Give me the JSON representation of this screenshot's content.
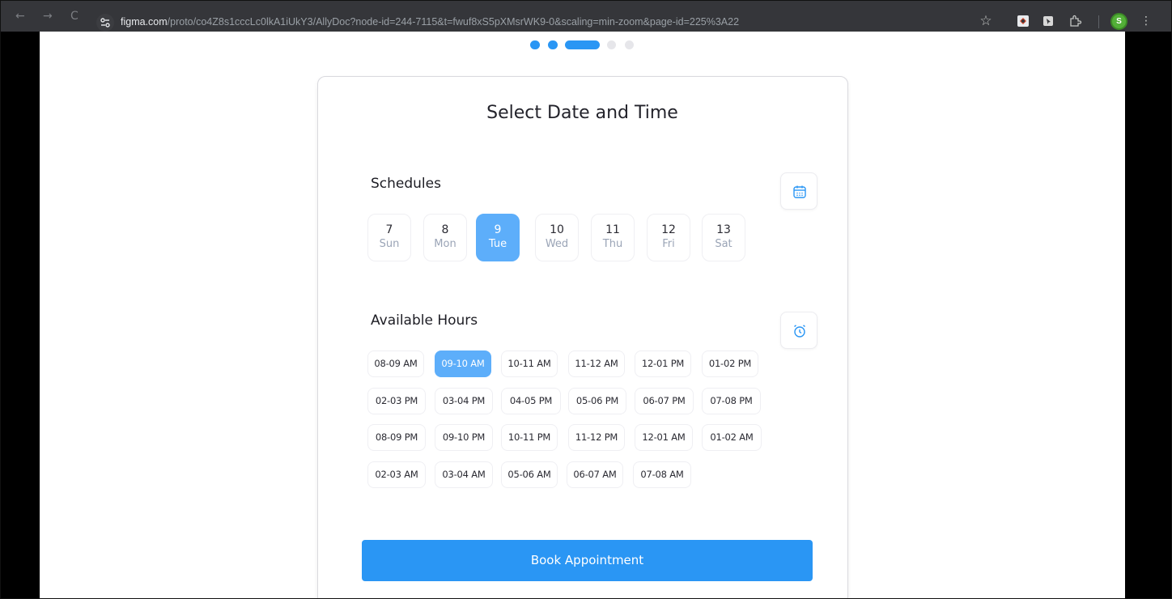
{
  "browser": {
    "back_icon": "←",
    "forward_icon": "→",
    "reload_icon": "C",
    "site_info_icon": "tune",
    "url_domain": "figma.com",
    "url_path": "/proto/co4Z8s1cccLc0lkA1iUkY3/AllyDoc?node-id=244-7115&t=fwuf8xS5pXMsrWK9-0&scaling=min-zoom&page-id=225%3A22",
    "star_icon": "☆",
    "avatar_letter": "S",
    "menu_icon": "⋮"
  },
  "steps": {
    "active_color": "#2a96f4",
    "inactive_color": "#e6e6ea",
    "count": 5,
    "active_index": 2
  },
  "page": {
    "title": "Select Date and Time",
    "schedules_label": "Schedules",
    "hours_label": "Available Hours",
    "book_button": "Book Appointment",
    "accent_color": "#2a96f4",
    "selected_color": "#5daefa"
  },
  "days": [
    {
      "num": "7",
      "name": "Sun",
      "selected": false
    },
    {
      "num": "8",
      "name": "Mon",
      "selected": false
    },
    {
      "num": "9",
      "name": "Tue",
      "selected": true
    },
    {
      "num": "10",
      "name": "Wed",
      "selected": false
    },
    {
      "num": "11",
      "name": "Thu",
      "selected": false
    },
    {
      "num": "12",
      "name": "Fri",
      "selected": false
    },
    {
      "num": "13",
      "name": "Sat",
      "selected": false
    }
  ],
  "slots": [
    "08-09 AM",
    "09-10 AM",
    "10-11 AM",
    "11-12 AM",
    "12-01 PM",
    "01-02 PM",
    "02-03 PM",
    "03-04 PM",
    "04-05 PM",
    "05-06 PM",
    "06-07 PM",
    "07-08 PM",
    "08-09 PM",
    "09-10 PM",
    "10-11 PM",
    "11-12 PM",
    "12-01 AM",
    "01-02 AM",
    "02-03 AM",
    "03-04 AM",
    "05-06 AM",
    "06-07 AM",
    "07-08 AM"
  ],
  "selected_slot": "09-10 AM",
  "icons": {
    "calendar": "calendar-icon",
    "alarm": "alarm-clock-icon"
  }
}
